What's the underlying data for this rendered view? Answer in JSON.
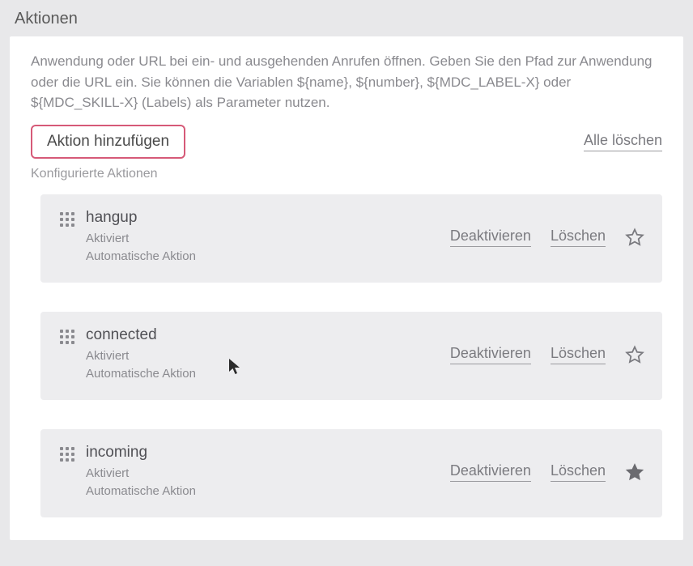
{
  "page": {
    "title": "Aktionen",
    "description": "Anwendung oder URL bei ein- und ausgehenden Anrufen öffnen. Geben Sie den Pfad zur Anwendung oder die URL ein. Sie können die Variablen ${name}, ${number}, ${MDC_LABEL-X} oder ${MDC_SKILL-X} (Labels) als Parameter nutzen."
  },
  "toolbar": {
    "add_label": "Aktion hinzufügen",
    "delete_all_label": "Alle löschen"
  },
  "subtitle": "Konfigurierte Aktionen",
  "labels": {
    "deactivate": "Deaktivieren",
    "delete": "Löschen"
  },
  "actions": [
    {
      "name": "hangup",
      "status": "Aktiviert",
      "type": "Automatische Aktion",
      "favorite": false
    },
    {
      "name": "connected",
      "status": "Aktiviert",
      "type": "Automatische Aktion",
      "favorite": false
    },
    {
      "name": "incoming",
      "status": "Aktiviert",
      "type": "Automatische Aktion",
      "favorite": true
    }
  ],
  "colors": {
    "accent_border": "#d65a78",
    "card_bg": "#ededef",
    "text_muted": "#8a8a8f"
  }
}
